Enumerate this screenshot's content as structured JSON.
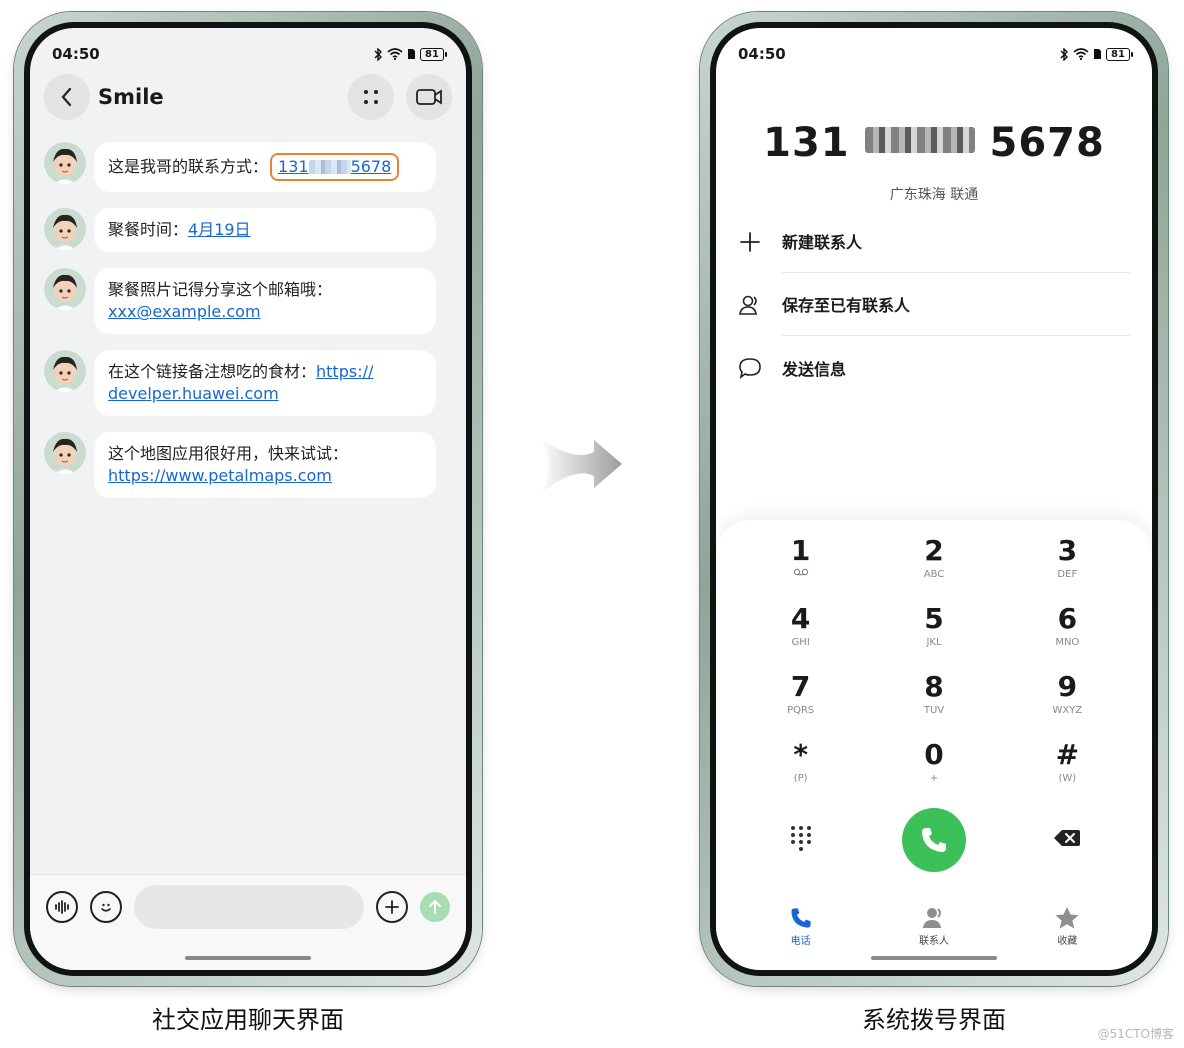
{
  "left_phone": {
    "status": {
      "time": "04:50",
      "battery": "81"
    },
    "header": {
      "contact_name": "Smile"
    },
    "messages": [
      {
        "text": "这是我哥的联系方式：",
        "link_prefix": "131",
        "link_suffix": "5678"
      },
      {
        "text": "聚餐时间：",
        "link": "4月19日"
      },
      {
        "text": "聚餐照片记得分享这个邮箱哦：",
        "link": "xxx@example.com"
      },
      {
        "text": "在这个链接备注想吃的食材：",
        "link_part1": "https://",
        "link_part2": "develper.huawei.com"
      },
      {
        "text": "这个地图应用很好用，快来试试：",
        "link": "https://www.petalmaps.com"
      }
    ],
    "input": {
      "placeholder": ""
    },
    "caption": "社交应用聊天界面"
  },
  "right_phone": {
    "status": {
      "time": "04:50",
      "battery": "81"
    },
    "number": {
      "prefix": "131",
      "suffix": "5678"
    },
    "location": "广东珠海 联通",
    "actions": [
      {
        "label": "新建联系人",
        "icon": "plus-icon"
      },
      {
        "label": "保存至已有联系人",
        "icon": "contacts-icon"
      },
      {
        "label": "发送信息",
        "icon": "message-icon"
      }
    ],
    "keys": [
      {
        "digit": "1",
        "sub": ""
      },
      {
        "digit": "2",
        "sub": "ABC"
      },
      {
        "digit": "3",
        "sub": "DEF"
      },
      {
        "digit": "4",
        "sub": "GHI"
      },
      {
        "digit": "5",
        "sub": "JKL"
      },
      {
        "digit": "6",
        "sub": "MNO"
      },
      {
        "digit": "7",
        "sub": "PQRS"
      },
      {
        "digit": "8",
        "sub": "TUV"
      },
      {
        "digit": "9",
        "sub": "WXYZ"
      },
      {
        "digit": "*",
        "sub": "(P)"
      },
      {
        "digit": "0",
        "sub": "+"
      },
      {
        "digit": "#",
        "sub": "(W)"
      }
    ],
    "tabs": [
      {
        "label": "电话"
      },
      {
        "label": "联系人"
      },
      {
        "label": "收藏"
      }
    ],
    "caption": "系统拨号界面"
  },
  "watermark": "@51CTO博客",
  "colors": {
    "link": "#1766d6",
    "highlight": "#e3843a",
    "call": "#3cc05a"
  }
}
